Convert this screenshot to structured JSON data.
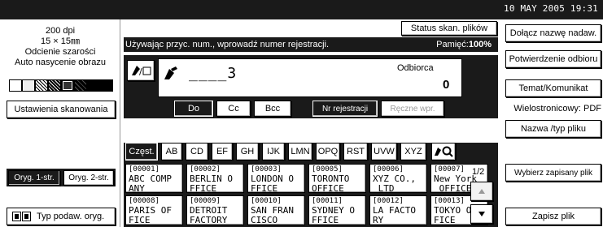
{
  "status_bar": {
    "clock": "10  MAY    2005  19:31"
  },
  "left_panel": {
    "resolution": "200 dpi",
    "size": "15 × 15㎜",
    "shade": "Odcienie szarości",
    "auto_density": "Auto nasycenie obrazu",
    "scan_settings": "Ustawienia skanowania",
    "orig_1side": "Oryg. 1-str.",
    "orig_2side": "Oryg. 2-str.",
    "feed_type": "Typ podaw. oryg."
  },
  "main": {
    "scan_status": "Status skan. plików",
    "instruction": "Używając przyc. num., wprowadź numer rejestracji.",
    "memory_label": "Pamięć:",
    "memory_value": "100%",
    "entry_value": "____3",
    "recipient_label": "Odbiorca",
    "recipient_count": "0",
    "to_label": "Do",
    "cc_label": "Cc",
    "bcc_label": "Bcc",
    "reg_no_label": "Nr rejestracji",
    "manual_label": "Ręczne wpr.",
    "tabs": [
      "Częst.",
      "AB",
      "CD",
      "EF",
      "GH",
      "IJK",
      "LMN",
      "OPQ",
      "RST",
      "UVW",
      "XYZ"
    ],
    "page_indicator": "1/2",
    "entries": [
      {
        "num": "[00001]",
        "name": "ABC COMP\nANY"
      },
      {
        "num": "[00002]",
        "name": "BERLIN O\nFFICE"
      },
      {
        "num": "[00003]",
        "name": "LONDON O\nFFICE"
      },
      {
        "num": "[00005]",
        "name": "TORONTO\nOFFICE"
      },
      {
        "num": "[00006]",
        "name": "XYZ CO.,\n LTD"
      },
      {
        "num": "[00007]",
        "name": "New York\n OFFICE"
      },
      {
        "num": "[00008]",
        "name": "PARIS OF\nFICE"
      },
      {
        "num": "[00009]",
        "name": "DETROIT\nFACTORY"
      },
      {
        "num": "[00010]",
        "name": "SAN FRAN\nCISCO"
      },
      {
        "num": "[00011]",
        "name": "SYDNEY O\nFFICE"
      },
      {
        "num": "[00012]",
        "name": "LA FACTO\nRY"
      },
      {
        "num": "[00013]",
        "name": "TOKYO OF\nFICE"
      }
    ]
  },
  "right_panel": {
    "attach_sender": "Dołącz nazwę nadaw.",
    "receipt_confirmation": "Potwierdzenie odbioru",
    "subject_message": "Temat/Komunikat",
    "multipage_pdf": "Wielostronicowy: PDF",
    "file_name_type": "Nazwa /typ pliku",
    "select_stored": "Wybierz zapisany plik",
    "store_file": "Zapisz plik"
  }
}
